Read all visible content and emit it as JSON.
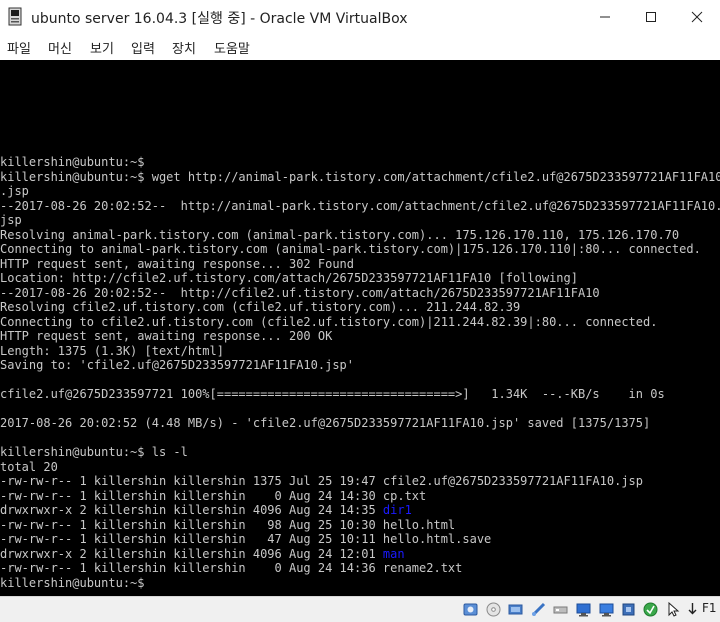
{
  "window": {
    "title": "ubunto server 16.04.3 [실행 중] - Oracle VM VirtualBox"
  },
  "menu": {
    "items": [
      "파일",
      "머신",
      "보기",
      "입력",
      "장치",
      "도움말"
    ]
  },
  "terminal": {
    "lines": [
      "killershin@ubuntu:~$",
      "killershin@ubuntu:~$ wget http://animal-park.tistory.com/attachment/cfile2.uf@2675D233597721AF11FA10",
      ".jsp",
      "--2017-08-26 20:02:52--  http://animal-park.tistory.com/attachment/cfile2.uf@2675D233597721AF11FA10.",
      "jsp",
      "Resolving animal-park.tistory.com (animal-park.tistory.com)... 175.126.170.110, 175.126.170.70",
      "Connecting to animal-park.tistory.com (animal-park.tistory.com)|175.126.170.110|:80... connected.",
      "HTTP request sent, awaiting response... 302 Found",
      "Location: http://cfile2.uf.tistory.com/attach/2675D233597721AF11FA10 [following]",
      "--2017-08-26 20:02:52--  http://cfile2.uf.tistory.com/attach/2675D233597721AF11FA10",
      "Resolving cfile2.uf.tistory.com (cfile2.uf.tistory.com)... 211.244.82.39",
      "Connecting to cfile2.uf.tistory.com (cfile2.uf.tistory.com)|211.244.82.39|:80... connected.",
      "HTTP request sent, awaiting response... 200 OK",
      "Length: 1375 (1.3K) [text/html]",
      "Saving to: 'cfile2.uf@2675D233597721AF11FA10.jsp'",
      "",
      "cfile2.uf@2675D233597721 100%[=================================>]   1.34K  --.-KB/s    in 0s",
      "",
      "2017-08-26 20:02:52 (4.48 MB/s) - 'cfile2.uf@2675D233597721AF11FA10.jsp' saved [1375/1375]",
      "",
      "killershin@ubuntu:~$ ls -l",
      "total 20"
    ],
    "listing": [
      {
        "prefix": "-rw-rw-r-- 1 killershin killershin 1375 Jul 25 19:47 ",
        "name": "cfile2.uf@2675D233597721AF11FA10.jsp",
        "is_dir": false
      },
      {
        "prefix": "-rw-rw-r-- 1 killershin killershin    0 Aug 24 14:30 ",
        "name": "cp.txt",
        "is_dir": false
      },
      {
        "prefix": "drwxrwxr-x 2 killershin killershin 4096 Aug 24 14:35 ",
        "name": "dir1",
        "is_dir": true
      },
      {
        "prefix": "-rw-rw-r-- 1 killershin killershin   98 Aug 25 10:30 ",
        "name": "hello.html",
        "is_dir": false
      },
      {
        "prefix": "-rw-rw-r-- 1 killershin killershin   47 Aug 25 10:11 ",
        "name": "hello.html.save",
        "is_dir": false
      },
      {
        "prefix": "drwxrwxr-x 2 killershin killershin 4096 Aug 24 12:01 ",
        "name": "man",
        "is_dir": true
      },
      {
        "prefix": "-rw-rw-r-- 1 killershin killershin    0 Aug 24 14:36 ",
        "name": "rename2.txt",
        "is_dir": false
      }
    ],
    "prompt": "killershin@ubuntu:~$",
    "dir_color": "#1a1aff",
    "text_color": "#c8c8c8"
  },
  "statusbar": {
    "icons": [
      "hard-disk-icon",
      "optical-drive-icon",
      "audio-icon",
      "network-icon",
      "usb-icon",
      "shared-folder-icon",
      "display-icon",
      "video-capture-icon",
      "cpu-icon",
      "mouse-integration-icon",
      "keyboard-capture-icon"
    ],
    "host_key": "F1"
  }
}
